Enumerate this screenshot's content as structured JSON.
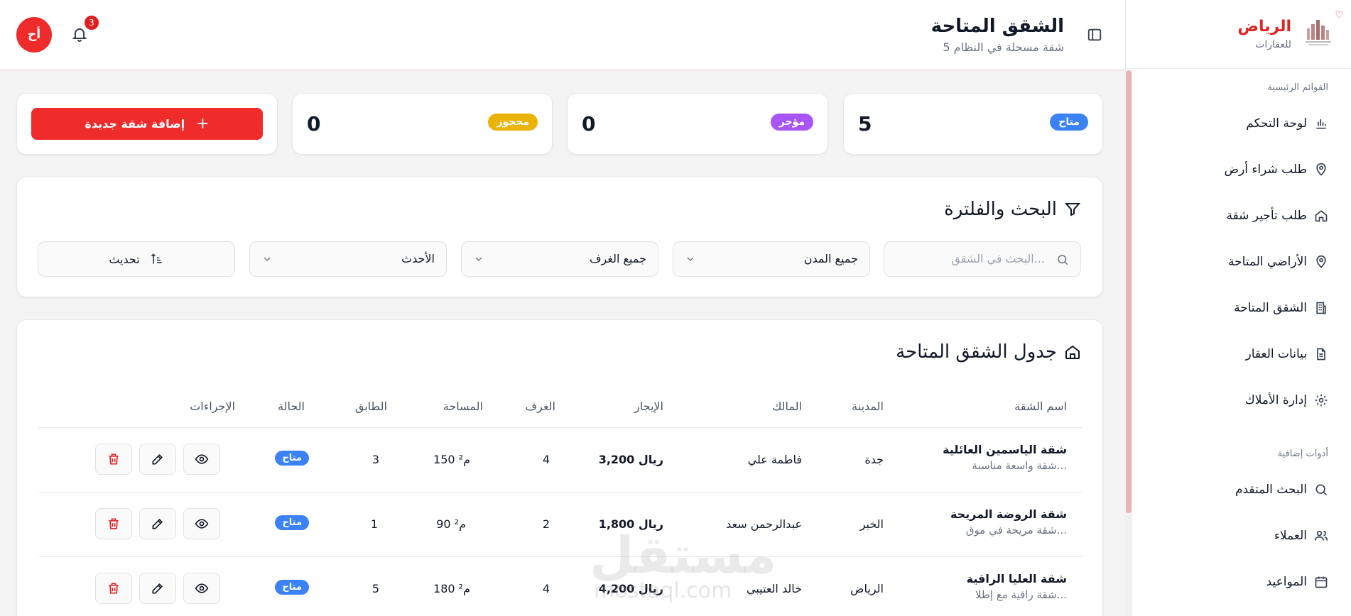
{
  "sidebar": {
    "brand_title": "الرياض",
    "brand_sub": "للعقارات",
    "section_main": "القوائم الرئيسية",
    "section_extra": "أدوات إضافية",
    "items": [
      {
        "label": "لوحة التحكم",
        "icon": "bar-chart-icon"
      },
      {
        "label": "طلب شراء أرض",
        "icon": "map-pin-icon"
      },
      {
        "label": "طلب تأجير شقة",
        "icon": "home-icon"
      },
      {
        "label": "الأراضي المتاحة",
        "icon": "map-pin-icon"
      },
      {
        "label": "الشقق المتاحة",
        "icon": "building-icon"
      },
      {
        "label": "بيانات العقار",
        "icon": "file-icon"
      },
      {
        "label": "إدارة الأملاك",
        "icon": "gear-icon"
      }
    ],
    "extra_items": [
      {
        "label": "البحث المتقدم",
        "icon": "search-icon"
      },
      {
        "label": "العملاء",
        "icon": "users-icon"
      },
      {
        "label": "المواعيد",
        "icon": "calendar-icon"
      }
    ]
  },
  "header": {
    "title": "الشقق المتاحة",
    "subtitle": "5 شقة مسجلة في النظام",
    "avatar_initials": "أح",
    "notifications": "3"
  },
  "stats": [
    {
      "label": "متاح",
      "value": "5",
      "color": "#3b82f6"
    },
    {
      "label": "مؤجر",
      "value": "0",
      "color": "#a855f7"
    },
    {
      "label": "محجوز",
      "value": "0",
      "color": "#eab308"
    }
  ],
  "add_button": "إضافة شقة جديدة",
  "filters": {
    "title": "البحث والفلترة",
    "search_placeholder": "البحث في الشقق...",
    "city": "جميع المدن",
    "rooms": "جميع الغرف",
    "sort": "الأحدث",
    "refresh": "تحديث"
  },
  "table": {
    "title": "جدول الشقق المتاحة",
    "columns": {
      "name": "اسم الشقة",
      "city": "المدينة",
      "owner": "المالك",
      "rent": "الإيجار",
      "rooms": "الغرف",
      "area": "المساحة",
      "floor": "الطابق",
      "status": "الحالة",
      "actions": "الإجراءات"
    },
    "rows": [
      {
        "name": "شقة الياسمين العائلية",
        "desc": "شقة واسعة مناسبة...",
        "city": "جدة",
        "owner": "فاطمة علي",
        "rent": "3,200 ريال",
        "rooms": "4",
        "area": "150 م²",
        "floor": "3",
        "status": "متاح"
      },
      {
        "name": "شقة الروضة المريحة",
        "desc": "شقة مريحة في موق...",
        "city": "الخبر",
        "owner": "عبدالرحمن سعد",
        "rent": "1,800 ريال",
        "rooms": "2",
        "area": "90 م²",
        "floor": "1",
        "status": "متاح"
      },
      {
        "name": "شقة العليا الراقية",
        "desc": "شقة راقية مع إطلا...",
        "city": "الرياض",
        "owner": "خالد العتيبي",
        "rent": "4,200 ريال",
        "rooms": "4",
        "area": "180 م²",
        "floor": "5",
        "status": "متاح"
      }
    ]
  },
  "watermark": {
    "text": "مستقل",
    "sub": "mostaql.com"
  }
}
